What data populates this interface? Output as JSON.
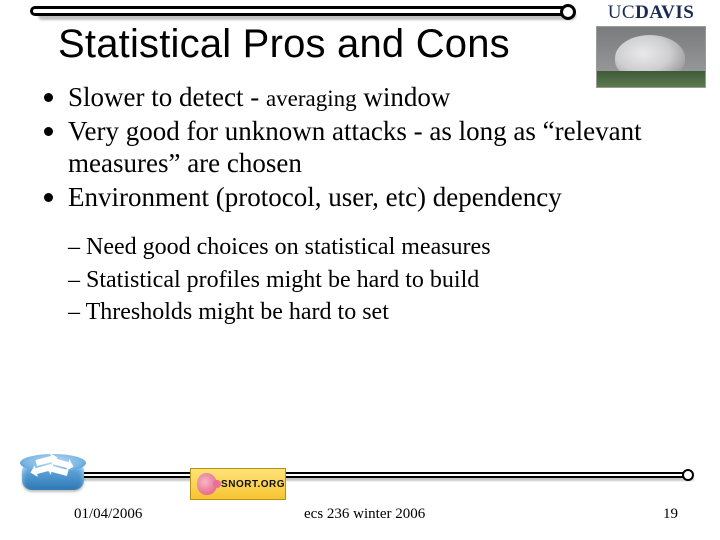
{
  "header": {
    "brand_uc": "UC",
    "brand_davis": "DAVIS"
  },
  "title": "Statistical Pros and Cons",
  "bullets": [
    {
      "pre": "Slower to detect - ",
      "avg": "averaging",
      "post": " window"
    },
    {
      "text": "Very good for unknown attacks - as long as “relevant measures” are chosen"
    },
    {
      "text": "Environment (protocol, user, etc) dependency"
    }
  ],
  "sub_bullets": [
    "Need good choices on statistical measures",
    "Statistical profiles might be hard to build",
    "Thresholds might be hard to set"
  ],
  "snort_label": "SNORT.ORG",
  "footer": {
    "date": "01/04/2006",
    "course": "ecs 236 winter 2006",
    "page": "19"
  }
}
